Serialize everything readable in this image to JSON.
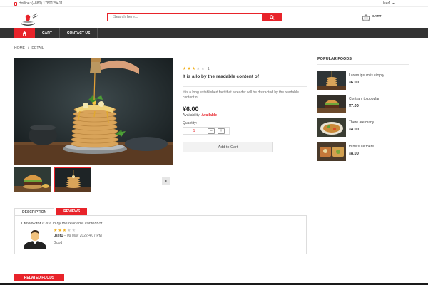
{
  "topbar": {
    "hotline": "Hotline: (+880) 1780129411",
    "user": "User1"
  },
  "header": {
    "search_placeholder": "Search here...",
    "cart_label": "CART"
  },
  "nav": {
    "items": [
      "CART",
      "CONTACT US"
    ]
  },
  "breadcrumb": [
    "HOME",
    "/",
    "DETAIL"
  ],
  "product": {
    "rating": 3,
    "max_rating": 5,
    "review_count": "1",
    "title": "It is a lo by the readable content of",
    "description": "It is a long established fact that a reader will be distracted by the readable content of",
    "price": "¥6.00",
    "availability_label": "Availability:",
    "availability_value": "Available",
    "quantity_label": "Quantity:",
    "quantity_value": "1",
    "minus": "−",
    "plus": "+",
    "add_to_cart": "Add to Cart"
  },
  "sidebar": {
    "title": "POPULAR FOODS",
    "items": [
      {
        "name": "Larem ipsum is simply",
        "price": "¥6.00"
      },
      {
        "name": "Contrary to popular",
        "price": "¥7.00"
      },
      {
        "name": "There are many",
        "price": "¥4.00"
      },
      {
        "name": "to be sure there",
        "price": "¥8.00"
      }
    ]
  },
  "tabs": {
    "description": "DESCRIPTION",
    "reviews": "REVIEWS"
  },
  "review": {
    "heading_prefix": "1 review for",
    "heading_title": "It is a lo by the readable content of",
    "rating": 3,
    "user": "user1",
    "date": "– 09 May 2022 4:07 PM",
    "text": "Good"
  },
  "related": {
    "label": "RELATED FOODS"
  },
  "colors": {
    "accent": "#e8232a",
    "nav_bg": "#333333",
    "star": "#f2b01e"
  }
}
